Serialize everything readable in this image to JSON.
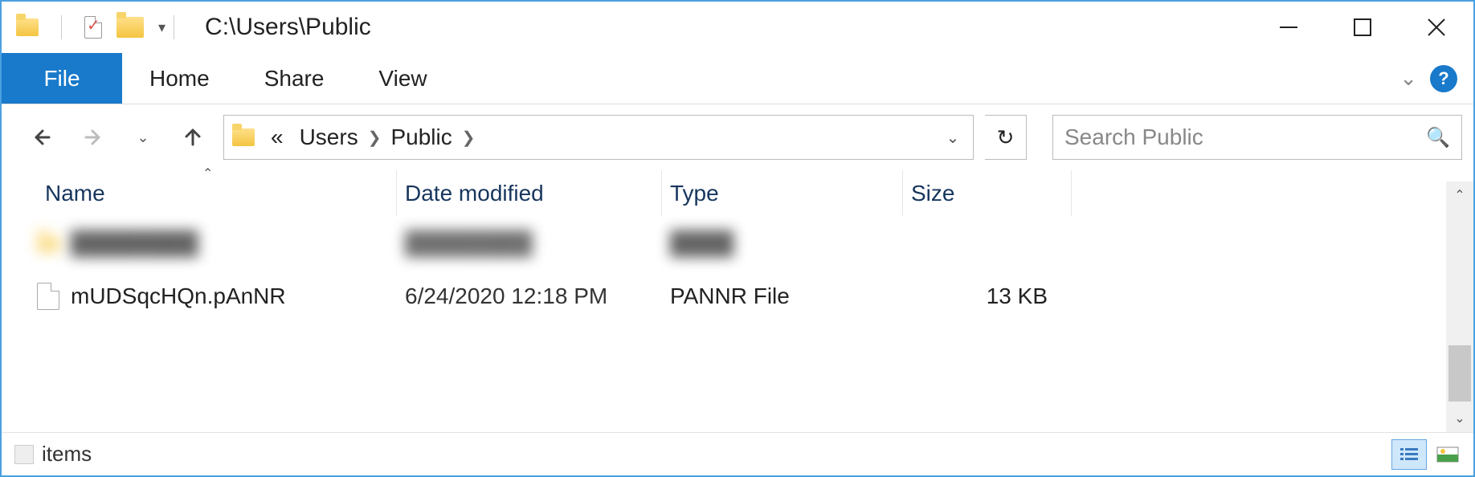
{
  "window": {
    "title": "C:\\Users\\Public"
  },
  "ribbon": {
    "file": "File",
    "tabs": [
      "Home",
      "Share",
      "View"
    ]
  },
  "breadcrumb": {
    "prefix": "«",
    "items": [
      "Users",
      "Public"
    ]
  },
  "search": {
    "placeholder": "Search Public"
  },
  "columns": {
    "name": "Name",
    "date": "Date modified",
    "type": "Type",
    "size": "Size"
  },
  "files": [
    {
      "name": "mUDSqcHQn.pAnNR",
      "date": "6/24/2020 12:18 PM",
      "type": "PANNR File",
      "size": "13 KB"
    }
  ],
  "status": {
    "text": "items"
  }
}
